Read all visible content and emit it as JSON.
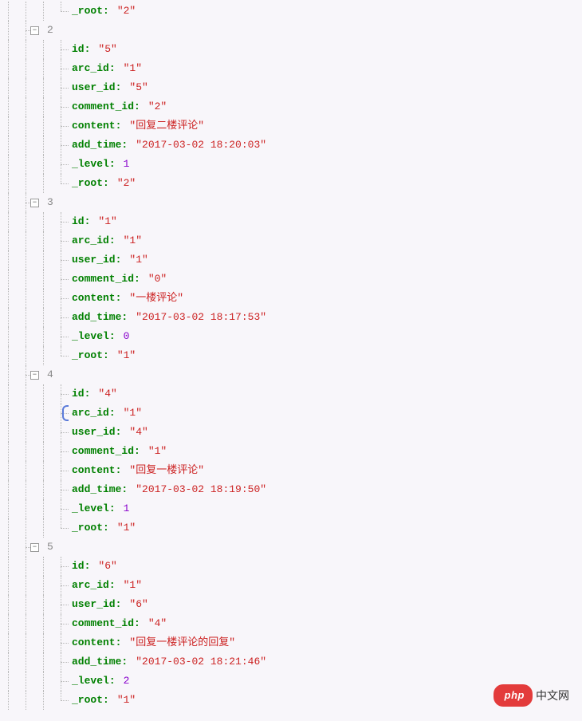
{
  "badge": {
    "pill": "php",
    "text": "中文网"
  },
  "toggle_glyph": "⊟",
  "partial_first_group_last": {
    "key": "_root",
    "value": "\"2\"",
    "type": "str"
  },
  "groups": [
    {
      "index": 2,
      "fields": [
        {
          "key": "id",
          "value": "\"5\"",
          "type": "str"
        },
        {
          "key": "arc_id",
          "value": "\"1\"",
          "type": "str"
        },
        {
          "key": "user_id",
          "value": "\"5\"",
          "type": "str"
        },
        {
          "key": "comment_id",
          "value": "\"2\"",
          "type": "str"
        },
        {
          "key": "content",
          "value": "\"回复二楼评论\"",
          "type": "str"
        },
        {
          "key": "add_time",
          "value": "\"2017-03-02 18:20:03\"",
          "type": "str"
        },
        {
          "key": "_level",
          "value": "1",
          "type": "num"
        },
        {
          "key": "_root",
          "value": "\"2\"",
          "type": "str"
        }
      ]
    },
    {
      "index": 3,
      "fields": [
        {
          "key": "id",
          "value": "\"1\"",
          "type": "str"
        },
        {
          "key": "arc_id",
          "value": "\"1\"",
          "type": "str"
        },
        {
          "key": "user_id",
          "value": "\"1\"",
          "type": "str"
        },
        {
          "key": "comment_id",
          "value": "\"0\"",
          "type": "str"
        },
        {
          "key": "content",
          "value": "\"一楼评论\"",
          "type": "str"
        },
        {
          "key": "add_time",
          "value": "\"2017-03-02 18:17:53\"",
          "type": "str"
        },
        {
          "key": "_level",
          "value": "0",
          "type": "num"
        },
        {
          "key": "_root",
          "value": "\"1\"",
          "type": "str"
        }
      ]
    },
    {
      "index": 4,
      "selected_field": 1,
      "fields": [
        {
          "key": "id",
          "value": "\"4\"",
          "type": "str"
        },
        {
          "key": "arc_id",
          "value": "\"1\"",
          "type": "str"
        },
        {
          "key": "user_id",
          "value": "\"4\"",
          "type": "str"
        },
        {
          "key": "comment_id",
          "value": "\"1\"",
          "type": "str"
        },
        {
          "key": "content",
          "value": "\"回复一楼评论\"",
          "type": "str"
        },
        {
          "key": "add_time",
          "value": "\"2017-03-02 18:19:50\"",
          "type": "str"
        },
        {
          "key": "_level",
          "value": "1",
          "type": "num"
        },
        {
          "key": "_root",
          "value": "\"1\"",
          "type": "str"
        }
      ]
    },
    {
      "index": 5,
      "fields": [
        {
          "key": "id",
          "value": "\"6\"",
          "type": "str"
        },
        {
          "key": "arc_id",
          "value": "\"1\"",
          "type": "str"
        },
        {
          "key": "user_id",
          "value": "\"6\"",
          "type": "str"
        },
        {
          "key": "comment_id",
          "value": "\"4\"",
          "type": "str"
        },
        {
          "key": "content",
          "value": "\"回复一楼评论的回复\"",
          "type": "str"
        },
        {
          "key": "add_time",
          "value": "\"2017-03-02 18:21:46\"",
          "type": "str"
        },
        {
          "key": "_level",
          "value": "2",
          "type": "num"
        },
        {
          "key": "_root",
          "value": "\"1\"",
          "type": "str"
        }
      ]
    }
  ]
}
